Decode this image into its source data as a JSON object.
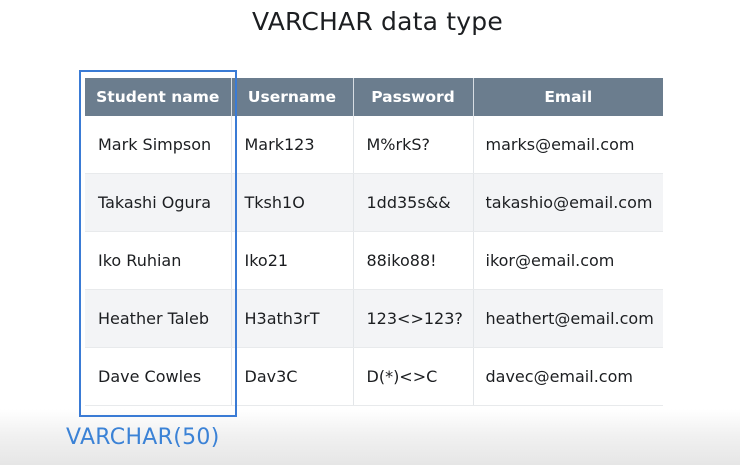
{
  "title": "VARCHAR data type",
  "table": {
    "headers": [
      "Student name",
      "Username",
      "Password",
      "Email"
    ],
    "rows": [
      [
        "Mark Simpson",
        "Mark123",
        "M%rkS?",
        "marks@email.com"
      ],
      [
        "Takashi Ogura",
        "Tksh1O",
        "1dd35s&&",
        "takashio@email.com"
      ],
      [
        "Iko Ruhian",
        "Iko21",
        "88iko88!",
        "ikor@email.com"
      ],
      [
        "Heather Taleb",
        "H3ath3rT",
        "123<>123?",
        "heathert@email.com"
      ],
      [
        "Dave Cowles",
        "Dav3C",
        "D(*)<>C",
        "davec@email.com"
      ]
    ]
  },
  "highlight_label": "VARCHAR(50)",
  "colors": {
    "header_bg": "#6b7d8e",
    "accent_blue": "#3b82d6",
    "row_alt": "#f3f4f6"
  }
}
